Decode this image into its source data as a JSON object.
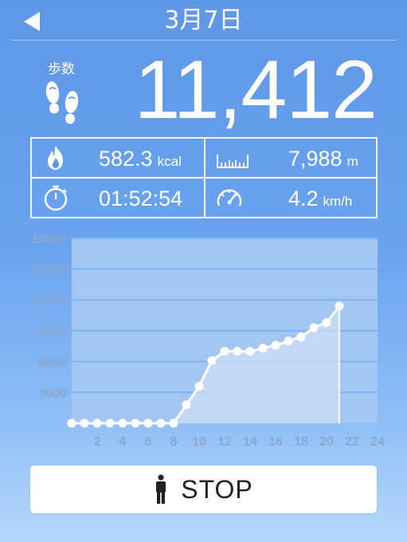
{
  "header": {
    "title": "3月7日",
    "back_icon": "back-arrow-icon"
  },
  "steps": {
    "label": "歩数",
    "value": "11,412",
    "icon": "footprints-icon"
  },
  "stats": {
    "calories": {
      "value": "582.3",
      "unit": "kcal",
      "icon": "flame-icon"
    },
    "distance": {
      "value": "7,988",
      "unit": "m",
      "icon": "ruler-icon"
    },
    "duration": {
      "value": "01:52:54",
      "icon": "stopwatch-icon"
    },
    "speed": {
      "value": "4.2",
      "unit": "km/h",
      "icon": "speedometer-icon"
    }
  },
  "chart_data": {
    "type": "area",
    "x": [
      0,
      1,
      2,
      3,
      4,
      5,
      6,
      7,
      8,
      9,
      10,
      11,
      12,
      13,
      14,
      15,
      16,
      17,
      18,
      19,
      20,
      21
    ],
    "values": [
      0,
      0,
      0,
      0,
      0,
      0,
      0,
      0,
      0,
      1800,
      3600,
      6100,
      7000,
      7000,
      7000,
      7300,
      7600,
      8000,
      8400,
      9300,
      9800,
      11412
    ],
    "xlim": [
      0,
      24
    ],
    "ylim": [
      0,
      18000
    ],
    "x_ticks": [
      "2",
      "4",
      "6",
      "8",
      "10",
      "12",
      "14",
      "16",
      "18",
      "20",
      "22",
      "24"
    ],
    "y_ticks": [
      "3000",
      "6000",
      "9000",
      "12000",
      "15000",
      "18000"
    ],
    "grid": true,
    "colors": {
      "line": "#ffffff",
      "fill": "#d6e3f7",
      "grid": "#7eb3f5",
      "ticks": "#8aa7cf",
      "plot_bg": "#a4c6f3"
    }
  },
  "stop_button": {
    "label": "STOP",
    "icon": "person-icon"
  }
}
